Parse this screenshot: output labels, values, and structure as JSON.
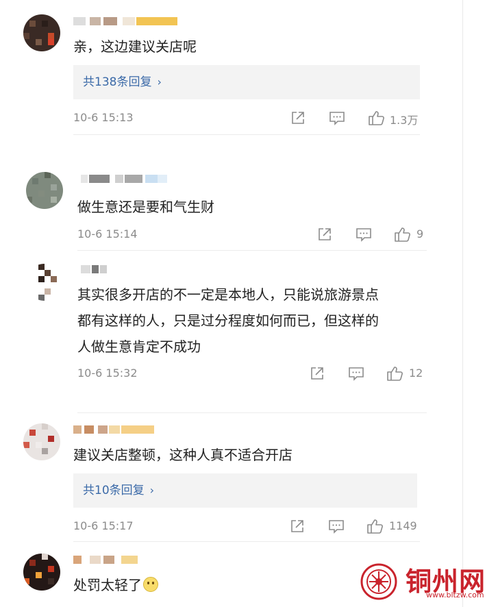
{
  "comments": [
    {
      "text": "亲，这边建议关店呢",
      "replies_label": "共138条回复",
      "time": "10-6 15:13",
      "likes": "1.3万"
    },
    {
      "text": "做生意还是要和气生财",
      "time": "10-6 15:14",
      "likes": "9"
    },
    {
      "text_lines": [
        "其实很多开店的不一定是本地人，只能说旅游景点",
        "都有这样的人，只是过分程度如何而已，但这样的",
        "人做生意肯定不成功"
      ],
      "time": "10-6 15:32",
      "likes": "12"
    },
    {
      "text": "建议关店整顿，这种人真不适合开店",
      "replies_label": "共10条回复",
      "time": "10-6 15:17",
      "likes": "1149"
    },
    {
      "text": "处罚太轻了"
    }
  ],
  "icons": {
    "share": "share-icon",
    "comment": "comment-icon",
    "like": "thumbs-up-icon",
    "reply_chevron": "chevron-right-icon",
    "emoji": "smile-emoji-icon"
  },
  "colors": {
    "link_blue": "#3b6aa8",
    "meta_gray": "#8b8b8b",
    "reply_bg": "#f3f3f3",
    "watermark_red": "#c9232c"
  },
  "watermark": {
    "title": "铜州网",
    "url": "www.bltzw.com"
  }
}
